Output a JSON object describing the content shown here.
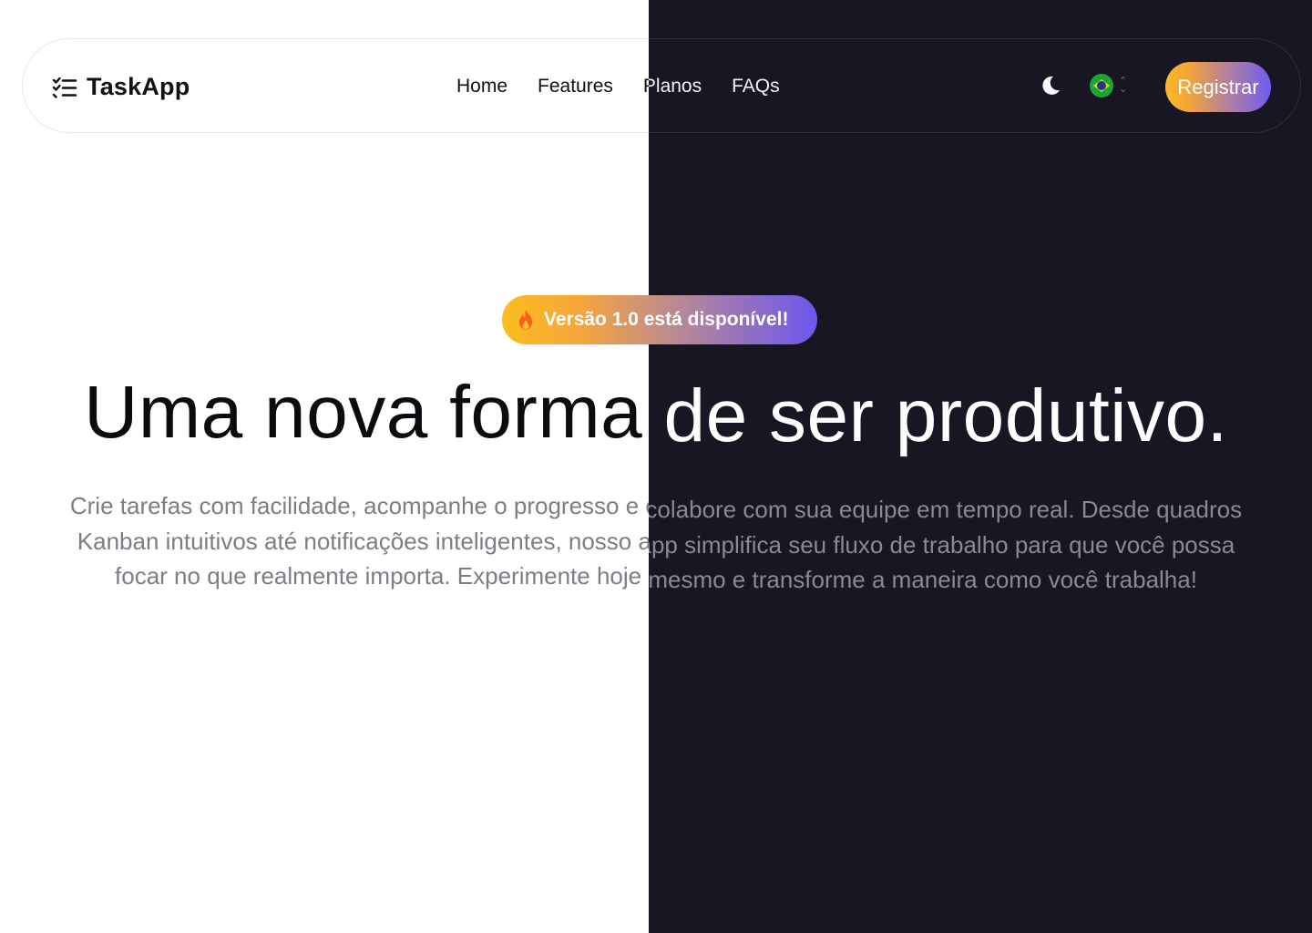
{
  "brand": {
    "name": "TaskApp",
    "icon": "list-check-icon"
  },
  "nav": {
    "links": [
      "Home",
      "Features",
      "Planos",
      "FAQs"
    ]
  },
  "controls": {
    "theme_icon": "moon-icon",
    "language_flag": "brazil-flag-icon",
    "language_chevron": "chevron-updown-icon",
    "register_label": "Registrar"
  },
  "hero": {
    "badge_icon": "fire-icon",
    "badge_text": "Versão 1.0 está disponível!",
    "headline": "Uma nova forma de ser produtivo.",
    "lead": "Crie tarefas com facilidade, acompanhe o progresso e colabore com sua equipe em tempo real. Desde quadros Kanban intuitivos até notificações inteligentes, nosso app simplifica seu fluxo de trabalho para que você possa focar no que realmente importa. Experimente hoje mesmo e transforme a maneira como você trabalha!"
  },
  "colors": {
    "light_background": "#ffffff",
    "dark_background": "#181622",
    "gradient_start": "#f8b92b",
    "gradient_end": "#6c56ee"
  }
}
